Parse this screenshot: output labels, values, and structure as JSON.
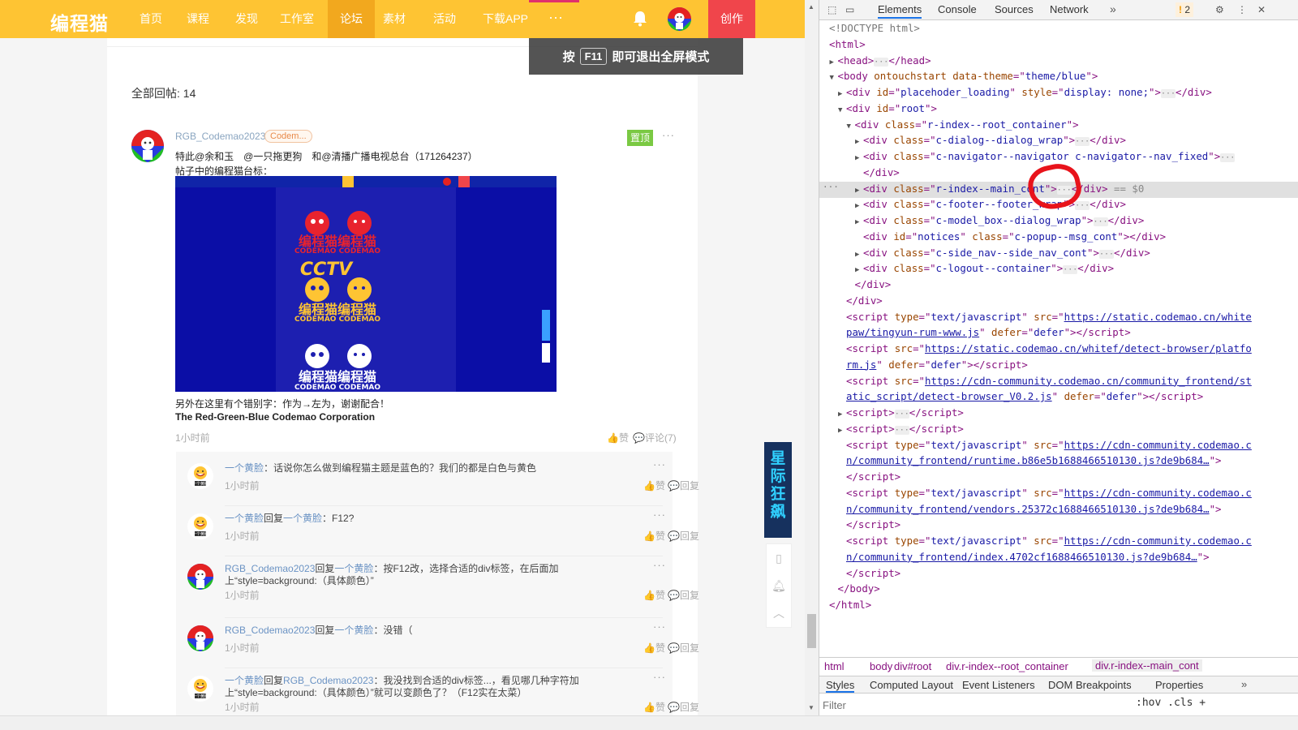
{
  "site": {
    "logo": "编程猫",
    "nav": [
      "首页",
      "课程",
      "发现",
      "工作室",
      "论坛",
      "素材",
      "活动",
      "下载APP"
    ],
    "nav_active_index": 4,
    "more": "···",
    "create": "创作",
    "toast": {
      "prefix": "按",
      "key": "F11",
      "suffix": "即可退出全屏模式"
    },
    "reply_count": "全部回帖: 14",
    "post": {
      "author": "RGB_Codemao2023",
      "badge": "Codem...",
      "pin": "置顶",
      "line1": "特此@余和玉　@一只拖更狗　和@清播广播电视总台（171264237）",
      "line2": "帖子中的编程猫台标：",
      "line3": "另外在这里有个错别字：作为→左为，谢谢配合！",
      "line4": "The Red-Green-Blue Codemao Corporation",
      "time": "1小时前",
      "like": "赞",
      "comment": "评论(7)"
    },
    "image": {
      "title1": "编程猫编程猫",
      "sub1": "CODEMAO CODEMAO",
      "cctv": "CCTV",
      "title2": "编程猫编程猫",
      "sub2": "CODEMAO CODEMAO",
      "title3": "编程猫编程猫",
      "sub3": "CODEMAO CODEMAO"
    },
    "comments": [
      {
        "user": "一个黄脸",
        "mid": "",
        "target": "",
        "text": "：话说你怎么做到编程猫主题是蓝色的？我们的都是白色与黄色",
        "time": "1小时前",
        "avatar": "yellow"
      },
      {
        "user": "一个黄脸",
        "mid": "回复",
        "target": "一个黄脸",
        "text": "：F12?",
        "time": "1小时前",
        "avatar": "yellow"
      },
      {
        "user": "RGB_Codemao2023",
        "mid": "回复",
        "target": "一个黄脸",
        "text": "：按F12改，选择合适的div标签，在后面加上“style=background:（具体颜色）”",
        "time": "1小时前",
        "avatar": "rgb"
      },
      {
        "user": "RGB_Codemao2023",
        "mid": "回复",
        "target": "一个黄脸",
        "text": "：没错（",
        "time": "1小时前",
        "avatar": "rgb"
      },
      {
        "user": "一个黄脸",
        "mid": "回复",
        "target": "RGB_Codemao2023",
        "text": "：我没找到合适的div标签...，看见哪几种字符加上“style=background:（具体颜色）”就可以变颜色了？（F12实在太菜）",
        "time": "1小时前",
        "avatar": "yellow"
      }
    ],
    "like": "赞",
    "reply": "回复",
    "side_promo": "星际狂飙"
  },
  "devtools": {
    "tabs": [
      "Elements",
      "Console",
      "Sources",
      "Network"
    ],
    "active_tab": "Elements",
    "more": "»",
    "warn_count": "2",
    "lines": [
      {
        "indent": 0,
        "tri": "",
        "html": "<span class='dc'>&lt;!DOCTYPE html&gt;</span>"
      },
      {
        "indent": 0,
        "tri": "",
        "html": "&lt;html&gt;"
      },
      {
        "indent": 1,
        "tri": "▶",
        "html": "&lt;head&gt;<span class='el'>···</span>&lt;/head&gt;"
      },
      {
        "indent": 1,
        "tri": "▼",
        "html": "&lt;body <span class='an'>ontouchstart</span> <span class='an'>data-theme</span>=\"<span class='av'>theme/blue</span>\"&gt;"
      },
      {
        "indent": 2,
        "tri": "▶",
        "html": "&lt;div <span class='an'>id</span>=\"<span class='av'>placehoder_loading</span>\" <span class='an'>style</span>=\"<span class='av'>display: none;</span>\"&gt;<span class='el'>···</span>&lt;/div&gt;"
      },
      {
        "indent": 2,
        "tri": "▼",
        "html": "&lt;div <span class='an'>id</span>=\"<span class='av'>root</span>\"&gt;"
      },
      {
        "indent": 3,
        "tri": "▼",
        "html": "&lt;div <span class='an'>class</span>=\"<span class='av'>r-index--root_container</span>\"&gt;"
      },
      {
        "indent": 4,
        "tri": "▶",
        "html": "&lt;div <span class='an'>class</span>=\"<span class='av'>c-dialog--dialog_wrap</span>\"&gt;<span class='el'>···</span>&lt;/div&gt;"
      },
      {
        "indent": 4,
        "tri": "▶",
        "html": "&lt;div <span class='an'>class</span>=\"<span class='av'>c-navigator--navigator c-navigator--nav_fixed</span>\"&gt;<span class='el'>···</span>"
      },
      {
        "indent": 4,
        "tri": "",
        "html": "&lt;/div&gt;"
      },
      {
        "indent": 4,
        "tri": "▶",
        "html": "&lt;div <span class='an'>class</span>=\"<span class='av'>r-index--main_cont</span>\"&gt;<span class='el'>···</span>&lt;/div&gt; <span class='sel0'>== $0</span>"
      },
      {
        "indent": 4,
        "tri": "▶",
        "html": "&lt;div <span class='an'>class</span>=\"<span class='av'>c-footer--footer_wrap</span>\"&gt;<span class='el'>···</span>&lt;/div&gt;"
      },
      {
        "indent": 4,
        "tri": "▶",
        "html": "&lt;div <span class='an'>class</span>=\"<span class='av'>c-model_box--dialog_wrap</span>\"&gt;<span class='el'>···</span>&lt;/div&gt;"
      },
      {
        "indent": 4,
        "tri": "",
        "html": "&lt;div <span class='an'>id</span>=\"<span class='av'>notices</span>\" <span class='an'>class</span>=\"<span class='av'>c-popup--msg_cont</span>\"&gt;&lt;/div&gt;"
      },
      {
        "indent": 4,
        "tri": "▶",
        "html": "&lt;div <span class='an'>class</span>=\"<span class='av'>c-side_nav--side_nav_cont</span>\"&gt;<span class='el'>···</span>&lt;/div&gt;"
      },
      {
        "indent": 4,
        "tri": "▶",
        "html": "&lt;div <span class='an'>class</span>=\"<span class='av'>c-logout--container</span>\"&gt;<span class='el'>···</span>&lt;/div&gt;"
      },
      {
        "indent": 3,
        "tri": "",
        "html": "&lt;/div&gt;"
      },
      {
        "indent": 2,
        "tri": "",
        "html": "&lt;/div&gt;"
      },
      {
        "indent": 2,
        "tri": "",
        "html": "&lt;script <span class='an'>type</span>=\"<span class='av'>text/javascript</span>\" <span class='an'>src</span>=\"<span class='lk'>https://static.codemao.cn/white</span>"
      },
      {
        "indent": 2,
        "tri": "",
        "html": "<span class='lk'>paw/tingyun-rum-www.js</span>\" <span class='an'>defer</span>=\"<span class='av'>defer</span>\"&gt;&lt;/script&gt;"
      },
      {
        "indent": 2,
        "tri": "",
        "html": "&lt;script <span class='an'>src</span>=\"<span class='lk'>https://static.codemao.cn/whitef/detect-browser/platfo</span>"
      },
      {
        "indent": 2,
        "tri": "",
        "html": "<span class='lk'>rm.js</span>\" <span class='an'>defer</span>=\"<span class='av'>defer</span>\"&gt;&lt;/script&gt;"
      },
      {
        "indent": 2,
        "tri": "",
        "html": "&lt;script <span class='an'>src</span>=\"<span class='lk'>https://cdn-community.codemao.cn/community_frontend/st</span>"
      },
      {
        "indent": 2,
        "tri": "",
        "html": "<span class='lk'>atic_script/detect-browser_V0.2.js</span>\" <span class='an'>defer</span>=\"<span class='av'>defer</span>\"&gt;&lt;/script&gt;"
      },
      {
        "indent": 2,
        "tri": "▶",
        "html": "&lt;script&gt;<span class='el'>···</span>&lt;/script&gt;"
      },
      {
        "indent": 2,
        "tri": "▶",
        "html": "&lt;script&gt;<span class='el'>···</span>&lt;/script&gt;"
      },
      {
        "indent": 2,
        "tri": "",
        "html": "&lt;script <span class='an'>type</span>=\"<span class='av'>text/javascript</span>\" <span class='an'>src</span>=\"<span class='lk'>https://cdn-community.codemao.c</span>"
      },
      {
        "indent": 2,
        "tri": "",
        "html": "<span class='lk'>n/community_frontend/runtime.b86e5b1688466510130.js?de9b684…</span>\"&gt;"
      },
      {
        "indent": 2,
        "tri": "",
        "html": "&lt;/script&gt;"
      },
      {
        "indent": 2,
        "tri": "",
        "html": "&lt;script <span class='an'>type</span>=\"<span class='av'>text/javascript</span>\" <span class='an'>src</span>=\"<span class='lk'>https://cdn-community.codemao.c</span>"
      },
      {
        "indent": 2,
        "tri": "",
        "html": "<span class='lk'>n/community_frontend/vendors.25372c1688466510130.js?de9b684…</span>\"&gt;"
      },
      {
        "indent": 2,
        "tri": "",
        "html": "&lt;/script&gt;"
      },
      {
        "indent": 2,
        "tri": "",
        "html": "&lt;script <span class='an'>type</span>=\"<span class='av'>text/javascript</span>\" <span class='an'>src</span>=\"<span class='lk'>https://cdn-community.codemao.c</span>"
      },
      {
        "indent": 2,
        "tri": "",
        "html": "<span class='lk'>n/community_frontend/index.4702cf1688466510130.js?de9b684…</span>\"&gt;"
      },
      {
        "indent": 2,
        "tri": "",
        "html": "&lt;/script&gt;"
      },
      {
        "indent": 1,
        "tri": "",
        "html": "&lt;/body&gt;"
      },
      {
        "indent": 0,
        "tri": "",
        "html": "&lt;/html&gt;"
      }
    ],
    "selected_line": 10,
    "breadcrumb": [
      "html",
      "body",
      "div#root",
      "div.r-index--root_container",
      "div.r-index--main_cont"
    ],
    "subtabs": [
      "Styles",
      "Computed",
      "Layout",
      "Event Listeners",
      "DOM Breakpoints",
      "Properties"
    ],
    "filter_placeholder": "Filter",
    "filter_tools": ":hov .cls +"
  },
  "colors": {
    "nav_bg": "#fec433",
    "nav_active": "#f2a81e",
    "create": "#f0454b",
    "pin": "#7ac943",
    "accent": "#1a73e8"
  }
}
